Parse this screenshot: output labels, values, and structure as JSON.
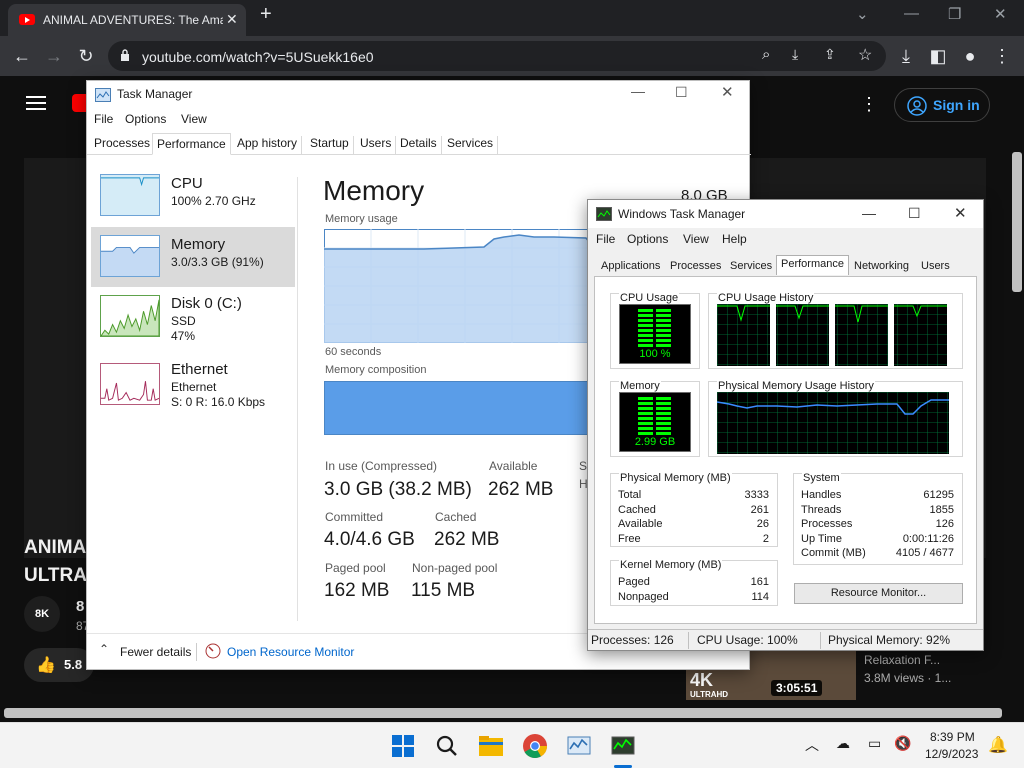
{
  "browser": {
    "tab_title": "ANIMAL ADVENTURES: The Ama",
    "url": "youtube.com/watch?v=5USuekk16e0"
  },
  "youtube": {
    "sign_in": "Sign in",
    "video_title_fragment": "ANIMA\nULTRA",
    "channel_initial": "8",
    "channel_sub_initial": "87",
    "like_count_fragment": "5.8",
    "suggested": {
      "title": "Relaxation F...",
      "views": "3.8M views · 1...",
      "duration": "3:05:51",
      "badge": "4K",
      "badge_sub": "ULTRAHD"
    },
    "channel_badge": "8K"
  },
  "taskmgr11": {
    "title": "Task Manager",
    "menu": [
      "File",
      "Options",
      "View"
    ],
    "tabs": [
      "Processes",
      "Performance",
      "App history",
      "Startup",
      "Users",
      "Details",
      "Services"
    ],
    "sidebar": [
      {
        "label": "CPU",
        "sub1": "100% 2.70 GHz",
        "sub2": "",
        "sub3": ""
      },
      {
        "label": "Memory",
        "sub1": "3.0/3.3 GB (91%)",
        "sub2": "",
        "sub3": ""
      },
      {
        "label": "Disk 0 (C:)",
        "sub1": "SSD",
        "sub2": "47%",
        "sub3": ""
      },
      {
        "label": "Ethernet",
        "sub1": "Ethernet",
        "sub2": "S: 0 R: 16.0 Kbps",
        "sub3": ""
      }
    ],
    "heading": "Memory",
    "total": "8.0 GB",
    "usage_label": "Memory usage",
    "seconds_label": "60 seconds",
    "composition_label": "Memory composition",
    "stats": {
      "in_use_label": "In use (Compressed)",
      "in_use_value": "3.0 GB (38.2 MB)",
      "available_label": "Available",
      "available_value": "262 MB",
      "sl_label": "Sl",
      "h_label": "H",
      "committed_label": "Committed",
      "committed_value": "4.0/4.6 GB",
      "cached_label": "Cached",
      "cached_value": "262 MB",
      "paged_label": "Paged pool",
      "paged_value": "162 MB",
      "nonpaged_label": "Non-paged pool",
      "nonpaged_value": "115 MB"
    },
    "footer": {
      "fewer_details": "Fewer details",
      "open_resource_monitor": "Open Resource Monitor"
    },
    "memory_usage_percent": 91
  },
  "taskmgr7": {
    "title": "Windows Task Manager",
    "menu": [
      "File",
      "Options",
      "View",
      "Help"
    ],
    "tabs": [
      "Applications",
      "Processes",
      "Services",
      "Performance",
      "Networking",
      "Users"
    ],
    "cpu_usage_label": "CPU Usage",
    "cpu_usage_value": "100 %",
    "cpu_history_label": "CPU Usage History",
    "memory_label": "Memory",
    "memory_value": "2.99 GB",
    "phys_history_label": "Physical Memory Usage History",
    "physical_memory": {
      "title": "Physical Memory (MB)",
      "rows": [
        {
          "label": "Total",
          "value": "3333"
        },
        {
          "label": "Cached",
          "value": "261"
        },
        {
          "label": "Available",
          "value": "26"
        },
        {
          "label": "Free",
          "value": "2"
        }
      ]
    },
    "kernel_memory": {
      "title": "Kernel Memory (MB)",
      "rows": [
        {
          "label": "Paged",
          "value": "161"
        },
        {
          "label": "Nonpaged",
          "value": "114"
        }
      ]
    },
    "system": {
      "title": "System",
      "rows": [
        {
          "label": "Handles",
          "value": "61295"
        },
        {
          "label": "Threads",
          "value": "1855"
        },
        {
          "label": "Processes",
          "value": "126"
        },
        {
          "label": "Up Time",
          "value": "0:00:11:26"
        },
        {
          "label": "Commit (MB)",
          "value": "4105 / 4677"
        }
      ]
    },
    "resource_monitor_button": "Resource Monitor...",
    "status": {
      "processes": "Processes: 126",
      "cpu": "CPU Usage: 100%",
      "physical": "Physical Memory: 92%"
    },
    "cpu_usage_percent": 100,
    "memory_usage_percent": 92
  },
  "taskbar": {
    "time": "8:39 PM",
    "date": "12/9/2023"
  },
  "colors": {
    "youtube_red": "#ff0000",
    "accent_blue": "#3ea6ff",
    "graph_blue": "#6da3d6",
    "gauge_green": "#00ff00"
  }
}
